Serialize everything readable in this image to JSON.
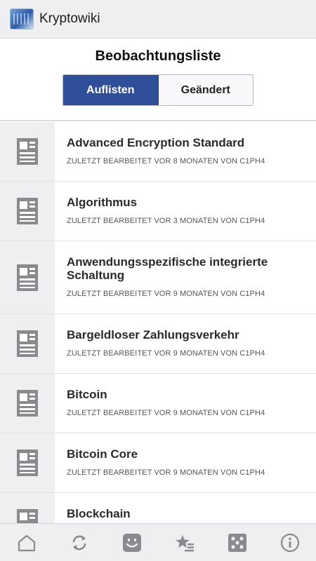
{
  "appbar": {
    "title": "Kryptowiki",
    "logo_icon": "app-logo-icon"
  },
  "header": {
    "title": "Beobachtungsliste",
    "segments": [
      {
        "label": "Auflisten",
        "active": true
      },
      {
        "label": "Geändert",
        "active": false
      }
    ]
  },
  "list": {
    "items": [
      {
        "title": "Advanced Encryption Standard",
        "meta": "ZULETZT BEARBEITET VOR 8 MONATEN VON C1PH4"
      },
      {
        "title": "Algorithmus",
        "meta": "ZULETZT BEARBEITET VOR 3 MONATEN VON C1PH4"
      },
      {
        "title": "Anwendungsspezifische integrierte Schaltung",
        "meta": "ZULETZT BEARBEITET VOR 9 MONATEN VON C1PH4"
      },
      {
        "title": "Bargeldloser Zahlungsverkehr",
        "meta": "ZULETZT BEARBEITET VOR 9 MONATEN VON C1PH4"
      },
      {
        "title": "Bitcoin",
        "meta": "ZULETZT BEARBEITET VOR 9 MONATEN VON C1PH4"
      },
      {
        "title": "Bitcoin Core",
        "meta": "ZULETZT BEARBEITET VOR 9 MONATEN VON C1PH4"
      },
      {
        "title": "Blockchain",
        "meta": ""
      }
    ]
  },
  "bottom_nav": {
    "items": [
      {
        "icon": "home-icon"
      },
      {
        "icon": "refresh-icon"
      },
      {
        "icon": "smiley-icon"
      },
      {
        "icon": "star-list-icon"
      },
      {
        "icon": "dice-icon"
      },
      {
        "icon": "info-icon"
      }
    ]
  },
  "colors": {
    "accent": "#2f4f98",
    "appbar_bg": "#efeff1",
    "icon_gray": "#8a8a8e"
  }
}
